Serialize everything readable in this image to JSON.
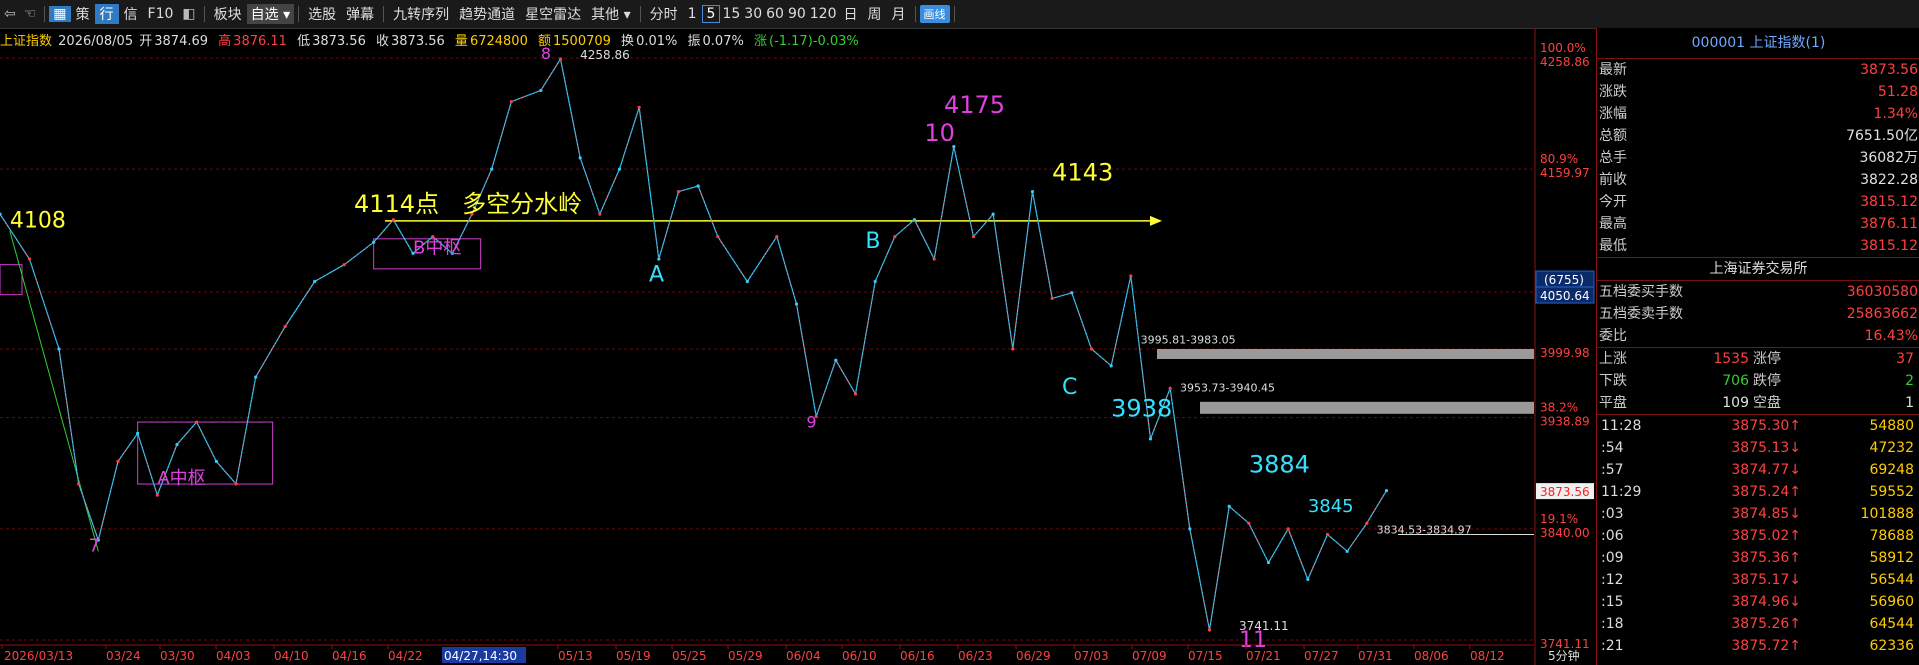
{
  "toolbar": {
    "items": [
      "策",
      "行",
      "信",
      "F10",
      "板块",
      "自选",
      "选股",
      "弹幕",
      "九转序列",
      "趋势通道",
      "星空雷达",
      "其他",
      "分时",
      "1",
      "5",
      "15",
      "30",
      "60",
      "90",
      "120",
      "日",
      "周",
      "月",
      "画线"
    ]
  },
  "info": {
    "name": "上证指数",
    "date": "2026/08/05",
    "open_label": "开",
    "open": "3874.69",
    "high_label": "高",
    "high": "3876.11",
    "low_label": "低",
    "low": "3873.56",
    "close_label": "收",
    "close": "3873.56",
    "volume_label": "量",
    "volume": "6724800",
    "amount_label": "额",
    "amount": "1500709",
    "turnover_label": "换",
    "turnover": "0.01%",
    "amplitude_label": "振",
    "amplitude": "0.07%",
    "change_label": "涨",
    "change": "(-1.17)-0.03%"
  },
  "chart_data": {
    "type": "line",
    "title": "上证指数",
    "interval": "5分钟",
    "ylim": [
      3741.11,
      4258.86
    ],
    "y_ticks": [
      {
        "value": 4258.86,
        "label": "4258.86",
        "pct": "100.0%"
      },
      {
        "value": 4159.97,
        "label": "4159.97",
        "pct": "80.9%"
      },
      {
        "value": 4050.64,
        "label": "4050.64",
        "pct": ""
      },
      {
        "value": 3999.98,
        "label": "3999.98",
        "pct": ""
      },
      {
        "value": 3938.89,
        "label": "3938.89",
        "pct": "38.2%"
      },
      {
        "value": 3840.0,
        "label": "3840.00",
        "pct": "19.1%"
      },
      {
        "value": 3741.11,
        "label": "3741.11",
        "pct": ""
      }
    ],
    "x_ticks": [
      "2026/03/13",
      "03/24",
      "03/30",
      "04/03",
      "04/10",
      "04/16",
      "04/22",
      "04/27,14:30",
      "05/13",
      "05/19",
      "05/25",
      "05/29",
      "06/04",
      "06/10",
      "06/16",
      "06/23",
      "06/29",
      "07/03",
      "07/09",
      "07/15",
      "07/21",
      "07/27",
      "07/31",
      "08/06",
      "08/12"
    ],
    "highlight_tick": "04/27,14:30",
    "cursor_price": "4050.64",
    "cursor_tag": "(6755)",
    "last_price": "3873.56",
    "series": [
      {
        "x": 0,
        "y": 4120
      },
      {
        "x": 3,
        "y": 4080
      },
      {
        "x": 6,
        "y": 4000
      },
      {
        "x": 8,
        "y": 3880
      },
      {
        "x": 10,
        "y": 3830
      },
      {
        "x": 12,
        "y": 3900
      },
      {
        "x": 14,
        "y": 3925
      },
      {
        "x": 16,
        "y": 3870
      },
      {
        "x": 18,
        "y": 3915
      },
      {
        "x": 20,
        "y": 3935
      },
      {
        "x": 22,
        "y": 3900
      },
      {
        "x": 24,
        "y": 3880
      },
      {
        "x": 26,
        "y": 3975
      },
      {
        "x": 29,
        "y": 4020
      },
      {
        "x": 32,
        "y": 4060
      },
      {
        "x": 35,
        "y": 4075
      },
      {
        "x": 38,
        "y": 4095
      },
      {
        "x": 40,
        "y": 4115
      },
      {
        "x": 42,
        "y": 4085
      },
      {
        "x": 44,
        "y": 4100
      },
      {
        "x": 46,
        "y": 4085
      },
      {
        "x": 48,
        "y": 4120
      },
      {
        "x": 50,
        "y": 4160
      },
      {
        "x": 52,
        "y": 4220
      },
      {
        "x": 55,
        "y": 4230
      },
      {
        "x": 57,
        "y": 4258
      },
      {
        "x": 59,
        "y": 4170
      },
      {
        "x": 61,
        "y": 4120
      },
      {
        "x": 63,
        "y": 4160
      },
      {
        "x": 65,
        "y": 4215
      },
      {
        "x": 67,
        "y": 4080
      },
      {
        "x": 69,
        "y": 4140
      },
      {
        "x": 71,
        "y": 4145
      },
      {
        "x": 73,
        "y": 4100
      },
      {
        "x": 76,
        "y": 4060
      },
      {
        "x": 79,
        "y": 4100
      },
      {
        "x": 81,
        "y": 4040
      },
      {
        "x": 83,
        "y": 3940
      },
      {
        "x": 85,
        "y": 3990
      },
      {
        "x": 87,
        "y": 3960
      },
      {
        "x": 89,
        "y": 4060
      },
      {
        "x": 91,
        "y": 4100
      },
      {
        "x": 93,
        "y": 4115
      },
      {
        "x": 95,
        "y": 4080
      },
      {
        "x": 97,
        "y": 4180
      },
      {
        "x": 99,
        "y": 4100
      },
      {
        "x": 101,
        "y": 4120
      },
      {
        "x": 103,
        "y": 4000
      },
      {
        "x": 105,
        "y": 4140
      },
      {
        "x": 107,
        "y": 4045
      },
      {
        "x": 109,
        "y": 4050
      },
      {
        "x": 111,
        "y": 4000
      },
      {
        "x": 113,
        "y": 3985
      },
      {
        "x": 115,
        "y": 4065
      },
      {
        "x": 117,
        "y": 3920
      },
      {
        "x": 119,
        "y": 3965
      },
      {
        "x": 121,
        "y": 3840
      },
      {
        "x": 123,
        "y": 3750
      },
      {
        "x": 125,
        "y": 3860
      },
      {
        "x": 127,
        "y": 3845
      },
      {
        "x": 129,
        "y": 3810
      },
      {
        "x": 131,
        "y": 3840
      },
      {
        "x": 133,
        "y": 3795
      },
      {
        "x": 135,
        "y": 3835
      },
      {
        "x": 137,
        "y": 3820
      },
      {
        "x": 139,
        "y": 3845
      },
      {
        "x": 141,
        "y": 3874
      }
    ],
    "annotations": [
      {
        "text": "4108",
        "x": 1,
        "y": 4108,
        "color": "#ffff33",
        "size": 22
      },
      {
        "text": "7",
        "x": 9,
        "y": 3820,
        "color": "#e040e0",
        "size": 18
      },
      {
        "text": "A中枢",
        "x": 16,
        "y": 3880,
        "color": "#e040e0",
        "size": 18
      },
      {
        "text": "4114点",
        "x": 36,
        "y": 4122,
        "color": "#ffff33",
        "size": 24
      },
      {
        "text": "多空分水岭",
        "x": 47,
        "y": 4122,
        "color": "#ffff33",
        "size": 24
      },
      {
        "text": "B中枢",
        "x": 42,
        "y": 4085,
        "color": "#e040e0",
        "size": 18
      },
      {
        "text": "8",
        "x": 55,
        "y": 4258,
        "color": "#e040e0",
        "size": 16
      },
      {
        "text": "4258.86",
        "x": 59,
        "y": 4258,
        "color": "#dddddd",
        "size": 12
      },
      {
        "text": "A",
        "x": 66,
        "y": 4060,
        "color": "#33e0ff",
        "size": 22
      },
      {
        "text": "9",
        "x": 82,
        "y": 3930,
        "color": "#e040e0",
        "size": 16
      },
      {
        "text": "B",
        "x": 88,
        "y": 4090,
        "color": "#33e0ff",
        "size": 22
      },
      {
        "text": "4175",
        "x": 96,
        "y": 4210,
        "color": "#e040e0",
        "size": 24
      },
      {
        "text": "10",
        "x": 94,
        "y": 4185,
        "color": "#e040e0",
        "size": 24
      },
      {
        "text": "4143",
        "x": 107,
        "y": 4150,
        "color": "#ffff33",
        "size": 24
      },
      {
        "text": "C",
        "x": 108,
        "y": 3960,
        "color": "#33e0ff",
        "size": 22
      },
      {
        "text": "3938",
        "x": 113,
        "y": 3940,
        "color": "#33e0ff",
        "size": 24
      },
      {
        "text": "3995.81-3983.05",
        "x": 116,
        "y": 4005,
        "color": "#dddddd",
        "size": 11
      },
      {
        "text": "3953.73-3940.45",
        "x": 120,
        "y": 3962,
        "color": "#dddddd",
        "size": 11
      },
      {
        "text": "3884",
        "x": 127,
        "y": 3890,
        "color": "#33e0ff",
        "size": 24
      },
      {
        "text": "3845",
        "x": 133,
        "y": 3855,
        "color": "#33e0ff",
        "size": 18
      },
      {
        "text": "3834.53-3834.97",
        "x": 140,
        "y": 3836,
        "color": "#dddddd",
        "size": 11
      },
      {
        "text": "3741.11",
        "x": 126,
        "y": 3750,
        "color": "#dddddd",
        "size": 12
      },
      {
        "text": "11",
        "x": 126,
        "y": 3735,
        "color": "#e040e0",
        "size": 22
      }
    ]
  },
  "panel": {
    "title": "000001 上证指数(1)",
    "quotes": [
      {
        "label": "最新",
        "value": "3873.56",
        "color": "red"
      },
      {
        "label": "涨跌",
        "value": "51.28",
        "color": "red"
      },
      {
        "label": "涨幅",
        "value": "1.34%",
        "color": "red"
      },
      {
        "label": "总额",
        "value": "7651.50亿",
        "color": "white"
      },
      {
        "label": "总手",
        "value": "36082万",
        "color": "white"
      },
      {
        "label": "前收",
        "value": "3822.28",
        "color": "white"
      },
      {
        "label": "今开",
        "value": "3815.12",
        "color": "red"
      },
      {
        "label": "最高",
        "value": "3876.11",
        "color": "red"
      },
      {
        "label": "最低",
        "value": "3815.12",
        "color": "red"
      }
    ],
    "exchange": "上海证券交易所",
    "orders": [
      {
        "label": "五档委买手数",
        "value": "36030580"
      },
      {
        "label": "五档委卖手数",
        "value": "25863662"
      },
      {
        "label": "委比",
        "value": "16.43%"
      }
    ],
    "breadth": [
      {
        "l1": "上涨",
        "v1": "1535",
        "l2": "涨停",
        "v2": "37"
      },
      {
        "l1": "下跌",
        "v1": "706",
        "l2": "跌停",
        "v2": "2"
      },
      {
        "l1": "平盘",
        "v1": "109",
        "l2": "空盘",
        "v2": "1"
      }
    ],
    "ticks": [
      {
        "t": "11:28",
        "p": "3875.30↑",
        "v": "54880",
        "up": true
      },
      {
        "t": ":54",
        "p": "3875.13↓",
        "v": "47232",
        "up": false
      },
      {
        "t": ":57",
        "p": "3874.77↓",
        "v": "69248",
        "up": false
      },
      {
        "t": "11:29",
        "p": "3875.24↑",
        "v": "59552",
        "up": true
      },
      {
        "t": ":03",
        "p": "3874.85↓",
        "v": "101888",
        "up": false
      },
      {
        "t": ":06",
        "p": "3875.02↑",
        "v": "78688",
        "up": true
      },
      {
        "t": ":09",
        "p": "3875.36↑",
        "v": "58912",
        "up": true
      },
      {
        "t": ":12",
        "p": "3875.17↓",
        "v": "56544",
        "up": false
      },
      {
        "t": ":15",
        "p": "3874.96↓",
        "v": "56960",
        "up": false
      },
      {
        "t": ":18",
        "p": "3875.26↑",
        "v": "64544",
        "up": true
      },
      {
        "t": ":21",
        "p": "3875.72↑",
        "v": "62336",
        "up": true
      }
    ]
  }
}
